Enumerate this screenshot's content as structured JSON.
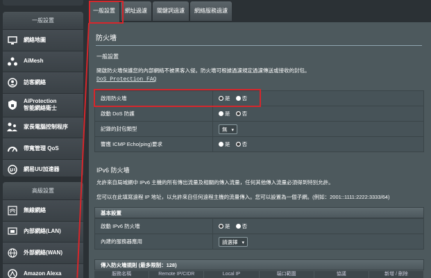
{
  "sidebar": {
    "general_header": "一般設置",
    "advanced_header": "高級設置",
    "general_items": [
      {
        "label": "網絡地圖",
        "icon": "network-map-icon"
      },
      {
        "label": "AiMesh",
        "icon": "aimesh-icon"
      },
      {
        "label": "訪客網絡",
        "icon": "guest-network-icon"
      },
      {
        "label": "AiProtection 智能網絡衛士",
        "label1": "AiProtection",
        "label2": "智能網絡衛士",
        "icon": "aiprotection-icon"
      },
      {
        "label": "家長電腦控制程序",
        "icon": "parental-control-icon"
      },
      {
        "label": "帶寬管理 QoS",
        "icon": "qos-icon"
      },
      {
        "label": "網易UU加速器",
        "icon": "uu-accelerator-icon"
      }
    ],
    "advanced_items": [
      {
        "label": "無線網絡",
        "icon": "wireless-icon"
      },
      {
        "label": "內部網絡(LAN)",
        "icon": "lan-icon"
      },
      {
        "label": "外部網絡(WAN)",
        "icon": "wan-icon"
      },
      {
        "label": "Amazon Alexa",
        "icon": "alexa-icon"
      }
    ]
  },
  "tabs": [
    "一般設置",
    "網址過濾",
    "關鍵詞過濾",
    "網絡服務過濾"
  ],
  "main": {
    "title": "防火墻",
    "section_general": "一般設置",
    "desc1": "開啟防火墻保護您的內部網絡不被黑客入侵。防火墻可根據過濾規定過濾傳送或接收的封包。",
    "faq_link": "DoS Protection FAQ",
    "rows": [
      {
        "label": "啟用防火墻",
        "yes": "是",
        "no": "否",
        "selected": "yes"
      },
      {
        "label": "啟動 DoS 防護",
        "yes": "是",
        "no": "否",
        "selected": "no"
      },
      {
        "label": "記錄的封包類型",
        "select": "無"
      },
      {
        "label": "響應 ICMP Echo(ping)要求",
        "yes": "是",
        "no": "否",
        "selected": "no"
      }
    ],
    "ipv6_title": "IPv6 防火墻",
    "ipv6_desc1": "允許來自局域網中 IPv6 主機的所有傳出流量及相關的傳入流量，任何其他傳入流量必須得到特別允許。",
    "ipv6_desc2": "您可以在此填寫遠程 IP 地址，以允許來自任何遠程主機的流量傳入。您可以設置為一個子網。(例如：2001::1111:2222:3333/64)",
    "basic_header": "基本設置",
    "ipv6_rows": [
      {
        "label": "啟動 IPv6 防火墻",
        "yes": "是",
        "no": "否",
        "selected": "yes"
      },
      {
        "label": "內建的服務器應用",
        "select": "請選擇"
      }
    ],
    "inbound_header": "傳入防火墻規則 (最多限制：128)",
    "grid_cols": [
      "服務名稱",
      "Remote IP/CIDR",
      "Local IP",
      "端口範圍",
      "協議",
      "新增 / 刪除"
    ]
  }
}
